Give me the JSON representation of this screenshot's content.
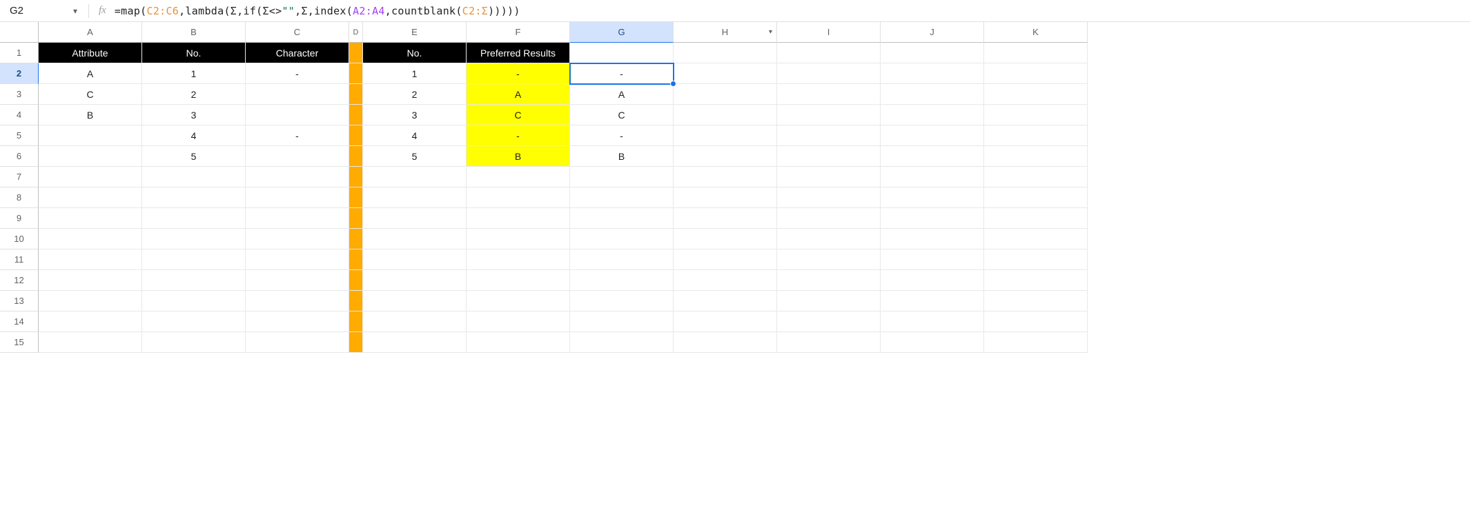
{
  "nameBox": "G2",
  "fxLabel": "fx",
  "formulaTokens": [
    {
      "t": "=map(",
      "c": "tok-plain"
    },
    {
      "t": "C2:C6",
      "c": "tok-range1"
    },
    {
      "t": ",lambda(Σ,if(Σ<>",
      "c": "tok-plain"
    },
    {
      "t": "\"\"",
      "c": "tok-str"
    },
    {
      "t": ",Σ,index(",
      "c": "tok-plain"
    },
    {
      "t": "A2:A4",
      "c": "tok-range2"
    },
    {
      "t": ",countblank(",
      "c": "tok-plain"
    },
    {
      "t": "C2:Σ",
      "c": "tok-range1"
    },
    {
      "t": ")))))",
      "c": "tok-plain"
    }
  ],
  "columns": [
    "A",
    "B",
    "C",
    "D",
    "E",
    "F",
    "G",
    "H",
    "I",
    "J",
    "K"
  ],
  "columnWidths": [
    "150px",
    "150px",
    "150px",
    "20px",
    "150px",
    "150px",
    "150px",
    "150px",
    "150px",
    "150px",
    "150px"
  ],
  "selectedCol": "G",
  "selectedRow": 2,
  "rowCount": 15,
  "rowNumbersWidth": "56px",
  "headerRowCells": {
    "A": "Attribute",
    "B": "No.",
    "C": "Character",
    "D": "",
    "E": "No.",
    "F": "Preferred Results"
  },
  "dataCells": {
    "2": {
      "A": "A",
      "B": "1",
      "C": "-",
      "E": "1",
      "F": "-",
      "G": "-"
    },
    "3": {
      "A": "C",
      "B": "2",
      "E": "2",
      "F": "A",
      "G": "A"
    },
    "4": {
      "A": "B",
      "B": "3",
      "E": "3",
      "F": "C",
      "G": "C"
    },
    "5": {
      "B": "4",
      "C": "-",
      "E": "4",
      "F": "-",
      "G": "-"
    },
    "6": {
      "B": "5",
      "E": "5",
      "F": "B",
      "G": "B"
    }
  },
  "yellowCells": [
    {
      "r": 2,
      "c": "F"
    },
    {
      "r": 3,
      "c": "F"
    },
    {
      "r": 4,
      "c": "F"
    },
    {
      "r": 5,
      "c": "F"
    },
    {
      "r": 6,
      "c": "F"
    }
  ],
  "blackHeaderCols": [
    "A",
    "B",
    "C",
    "D",
    "E",
    "F"
  ],
  "orangeCol": "D",
  "columnWithFilterIcon": "H",
  "activeCell": {
    "r": 2,
    "c": "G"
  }
}
